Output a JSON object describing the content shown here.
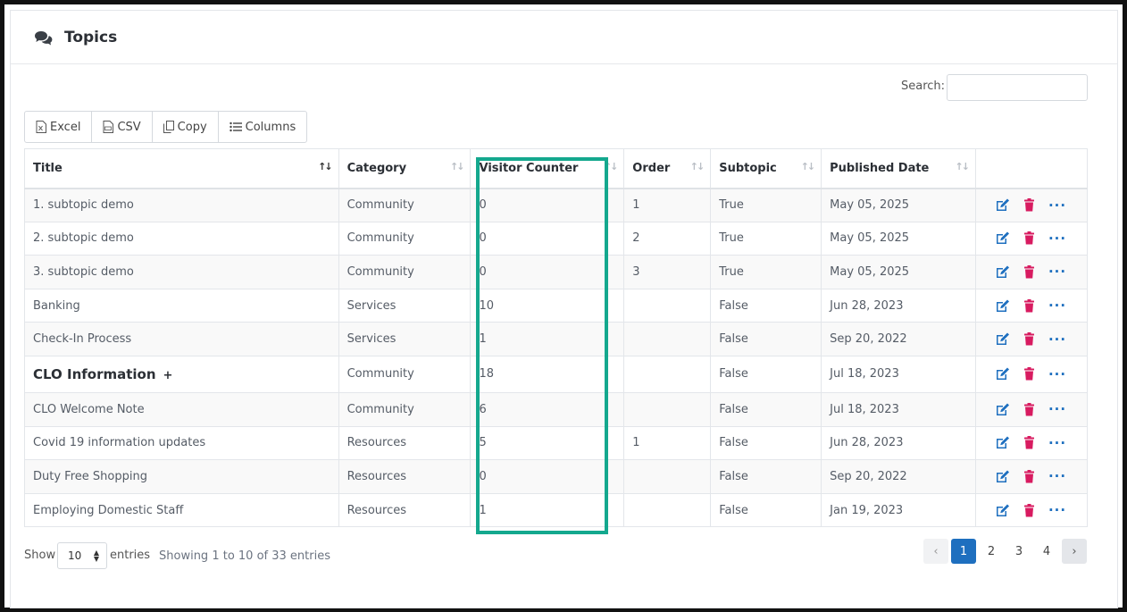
{
  "header": {
    "title": "Topics",
    "icon": "comments-icon"
  },
  "search": {
    "label": "Search:",
    "value": "",
    "placeholder": ""
  },
  "toolbar": {
    "excel": "Excel",
    "csv": "CSV",
    "copy": "Copy",
    "columns": "Columns"
  },
  "table": {
    "columns": [
      "Title",
      "Category",
      "Visitor Counter",
      "Order",
      "Subtopic",
      "Published Date"
    ],
    "rows": [
      {
        "title": "1. subtopic demo",
        "category": "Community",
        "visitors": "0",
        "order": "1",
        "subtopic": "True",
        "date": "May 05, 2025"
      },
      {
        "title": "2. subtopic demo",
        "category": "Community",
        "visitors": "0",
        "order": "2",
        "subtopic": "True",
        "date": "May 05, 2025"
      },
      {
        "title": "3. subtopic demo",
        "category": "Community",
        "visitors": "0",
        "order": "3",
        "subtopic": "True",
        "date": "May 05, 2025"
      },
      {
        "title": "Banking",
        "category": "Services",
        "visitors": "10",
        "order": "",
        "subtopic": "False",
        "date": "Jun 28, 2023"
      },
      {
        "title": "Check-In Process",
        "category": "Services",
        "visitors": "1",
        "order": "",
        "subtopic": "False",
        "date": "Sep 20, 2022"
      },
      {
        "title": "CLO Information",
        "category": "Community",
        "visitors": "18",
        "order": "",
        "subtopic": "False",
        "date": "Jul 18, 2023",
        "expand": "+"
      },
      {
        "title": "CLO Welcome Note",
        "category": "Community",
        "visitors": "6",
        "order": "",
        "subtopic": "False",
        "date": "Jul 18, 2023"
      },
      {
        "title": "Covid 19 information updates",
        "category": "Resources",
        "visitors": "5",
        "order": "1",
        "subtopic": "False",
        "date": "Jun 28, 2023"
      },
      {
        "title": "Duty Free Shopping",
        "category": "Resources",
        "visitors": "0",
        "order": "",
        "subtopic": "False",
        "date": "Sep 20, 2022"
      },
      {
        "title": "Employing Domestic Staff",
        "category": "Resources",
        "visitors": "1",
        "order": "",
        "subtopic": "False",
        "date": "Jan 19, 2023"
      }
    ],
    "action_icons": [
      "edit-icon",
      "trash-icon",
      "more-icon"
    ]
  },
  "footer": {
    "show_label": "Show",
    "page_length": "10",
    "entries_label": "entries",
    "info": "Showing 1 to 10 of 33 entries",
    "pages": [
      "1",
      "2",
      "3",
      "4"
    ],
    "current_page": "1"
  },
  "colors": {
    "accent": "#1e6fbf",
    "delete": "#d81b60",
    "highlight": "#14a88e"
  }
}
